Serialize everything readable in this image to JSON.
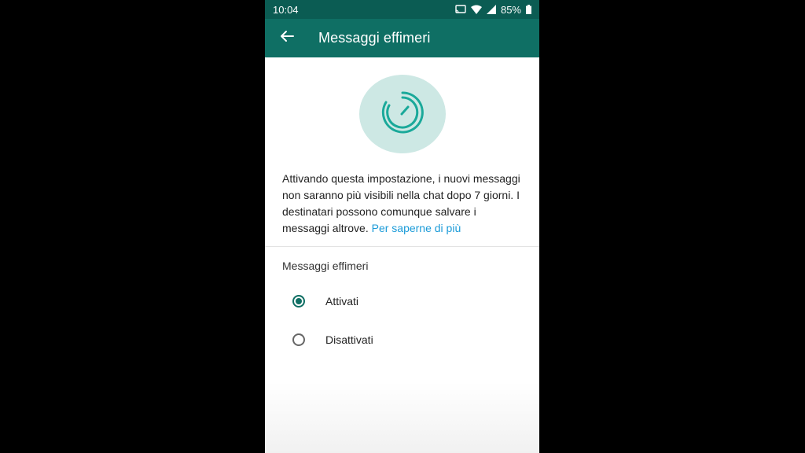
{
  "status_bar": {
    "time": "10:04",
    "battery": "85%",
    "icons": [
      "cast-icon",
      "wifi-icon",
      "signal-icon",
      "battery-icon"
    ]
  },
  "app_bar": {
    "back_icon": "arrow-left-icon",
    "title": "Messaggi effimeri"
  },
  "illustration": {
    "icon": "disappearing-timer-icon"
  },
  "description": {
    "text": "Attivando questa impostazione, i nuovi messaggi non saranno più visibili nella chat dopo 7 giorni. I destinatari possono comunque salvare i messaggi altrove.",
    "link": "Per saperne di più"
  },
  "setting": {
    "label": "Messaggi effimeri",
    "options": [
      {
        "label": "Attivati",
        "selected": true
      },
      {
        "label": "Disattivati",
        "selected": false
      }
    ]
  },
  "colors": {
    "app_bar": "#0f6f64",
    "status_bar": "#0b5c53",
    "accent": "#0f6f64",
    "link": "#1b9bd8",
    "illustration_bg": "#cde8e4"
  }
}
